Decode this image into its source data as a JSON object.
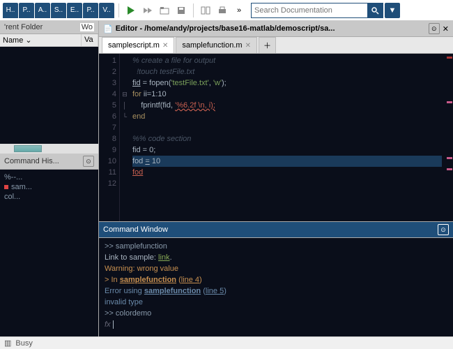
{
  "topTabs": [
    "H..",
    "P..",
    "A..",
    "S..",
    "E..",
    "P..",
    "V.."
  ],
  "search": {
    "placeholder": "Search Documentation"
  },
  "folder": {
    "title": "'rent Folder",
    "extra": "Wo",
    "cols": [
      "Name ⌄",
      "Va"
    ]
  },
  "history": {
    "title": "Command His...",
    "items": [
      "%--...",
      "sam...",
      "col..."
    ]
  },
  "editor": {
    "title": "Editor - /home/andy/projects/base16-matlab/demoscript/sa...",
    "tabs": [
      "samplescript.m",
      "samplefunction.m"
    ],
    "lines": 12
  },
  "code": {
    "l1": "% create a file for output",
    "l2": "  !touch testFile.txt",
    "l3a": "fid",
    "l3b": " = fopen(",
    "l3c": "'testFile.txt'",
    "l3d": ", ",
    "l3e": "'w'",
    "l3f": ");",
    "l4a": "for",
    "l4b": " ii=1:10",
    "l5a": "    fprintf(fid, ",
    "l5b": "'%6.2f \\n, i);",
    "l6": "end",
    "l8": "%% code section",
    "l9": "fid = 0;",
    "l10a": "fod ",
    "l10b": "=",
    "l10c": " 10",
    "l11": "fod"
  },
  "cmd": {
    "title": "Command Window",
    "p1": ">> samplefunction",
    "p2a": "Link to sample: ",
    "p2b": "link",
    "p2c": ".",
    "p3": "Warning: wrong value",
    "p4a": "> In ",
    "p4b": "samplefunction",
    "p4c": " (",
    "p4d": "line 4",
    "p4e": ")",
    "p5a": "Error using ",
    "p5b": "samplefunction",
    "p5c": " (",
    "p5d": "line 5",
    "p5e": ")",
    "p6": "invalid type",
    "p7": ">> colordemo",
    "fx": "fx"
  },
  "status": {
    "busy": "Busy"
  }
}
